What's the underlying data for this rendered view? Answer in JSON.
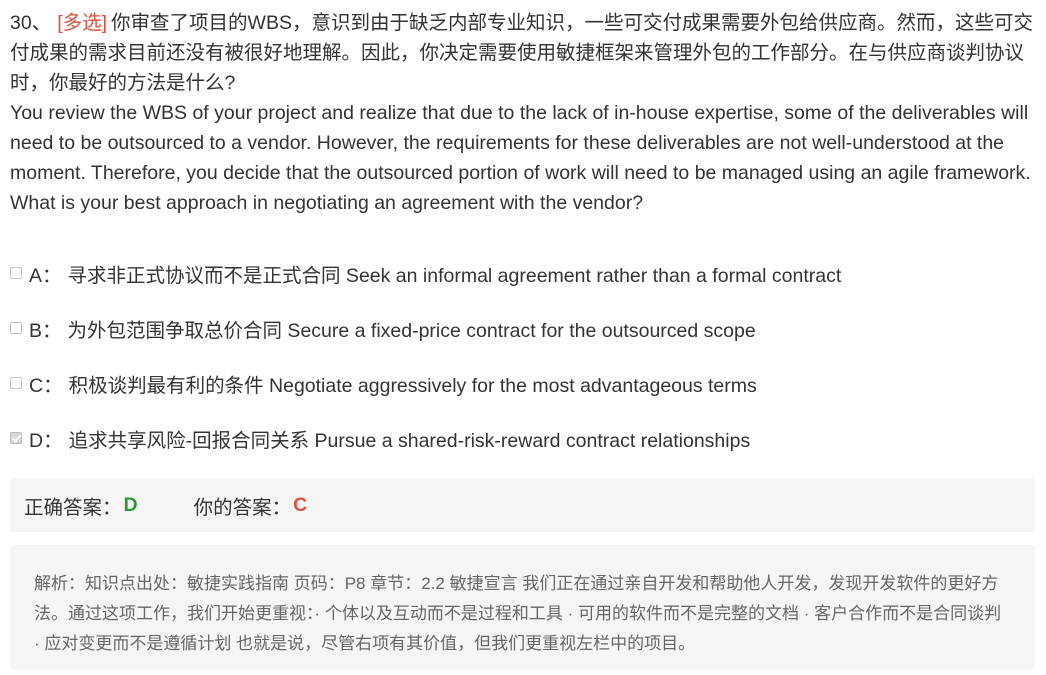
{
  "question": {
    "number": "30、",
    "type_tag": "[多选]",
    "text_cn": "你审查了项目的WBS，意识到由于缺乏内部专业知识，一些可交付成果需要外包给供应商。然而，这些可交付成果的需求目前还没有被很好地理解。因此，你决定需要使用敏捷框架来管理外包的工作部分。在与供应商谈判协议时，你最好的方法是什么?",
    "text_en": "You review the WBS of your project and realize that due to the lack of in-house expertise, some of the deliverables will need to be outsourced to a vendor. However, the requirements for these deliverables are not well-understood at the moment. Therefore, you decide that the outsourced portion of work will need to be managed using an agile framework. What is your best approach in negotiating an agreement with the vendor?"
  },
  "options": [
    {
      "letter": "A：",
      "text": "寻求非正式协议而不是正式合同 Seek an informal agreement rather than a formal contract",
      "checked": false
    },
    {
      "letter": "B：",
      "text": "为外包范围争取总价合同 Secure a fixed-price contract for the outsourced scope",
      "checked": false
    },
    {
      "letter": "C：",
      "text": "积极谈判最有利的条件 Negotiate aggressively for the most advantageous terms",
      "checked": false
    },
    {
      "letter": "D：",
      "text": " 追求共享风险-回报合同关系 Pursue a shared-risk-reward contract relationships",
      "checked": true
    }
  ],
  "answer": {
    "correct_label": "正确答案：",
    "correct_value": "D",
    "your_label": "你的答案：",
    "your_value": "C"
  },
  "analysis": {
    "text": "解析：知识点出处：敏捷实践指南 页码：P8 章节：2.2 敏捷宣言 我们正在通过亲自开发和帮助他人开发，发现开发软件的更好方法。通过这项工作，我们开始更重视：· 个体以及互动而不是过程和工具 · 可用的软件而不是完整的文档 · 客户合作而不是合同谈判 · 应对变更而不是遵循计划 也就是说，尽管右项有其价值，但我们更重视左栏中的项目。"
  },
  "colors": {
    "type_tag": "#e0513f",
    "correct": "#2e9b3a",
    "wrong": "#e0513f",
    "panel_bg": "#f5f5f5"
  }
}
